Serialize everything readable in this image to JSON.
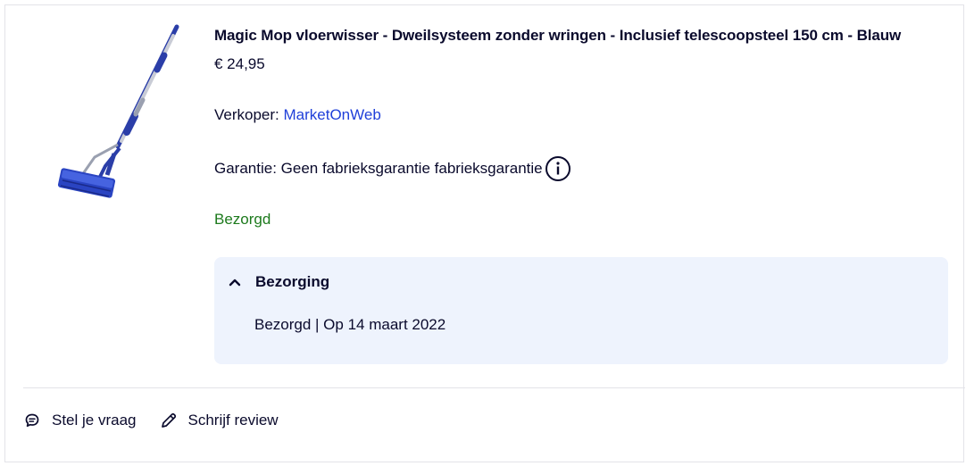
{
  "product": {
    "title": "Magic Mop vloerwisser - Dweilsysteem zonder wringen - Inclusief telescoopsteel 150 cm - Blauw",
    "price": "€ 24,95",
    "image_icon": "mop-product-image"
  },
  "seller": {
    "label": "Verkoper: ",
    "name": "MarketOnWeb"
  },
  "warranty": {
    "text": "Garantie: Geen fabrieksgarantie fabrieksgarantie",
    "icon": "info-icon"
  },
  "status": {
    "text": "Bezorgd",
    "color": "#1d7a1d"
  },
  "delivery": {
    "title": "Bezorging",
    "detail": "Bezorgd | Op 14 maart 2022",
    "icon": "chevron-up-icon",
    "background": "#eef3fd"
  },
  "actions": {
    "ask_question": "Stel je vraag",
    "ask_icon": "chat-bubble-icon",
    "write_review": "Schrijf review",
    "review_icon": "pencil-icon"
  },
  "colors": {
    "link": "#1f3fd9",
    "text": "#0a0a2c",
    "border": "#e3e3e8"
  }
}
